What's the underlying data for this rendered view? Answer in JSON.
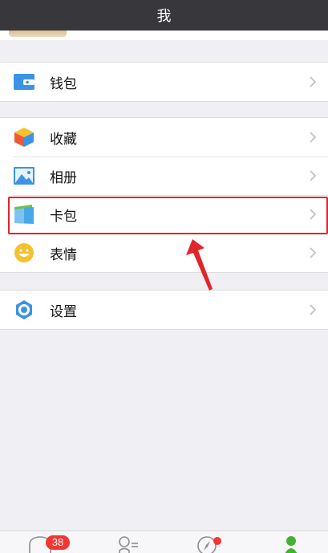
{
  "header": {
    "title": "我"
  },
  "groups": [
    {
      "items": [
        {
          "label": "钱包",
          "icon": "wallet-icon"
        }
      ]
    },
    {
      "items": [
        {
          "label": "收藏",
          "icon": "favorites-cube-icon"
        },
        {
          "label": "相册",
          "icon": "album-photo-icon"
        },
        {
          "label": "卡包",
          "icon": "card-package-icon"
        },
        {
          "label": "表情",
          "icon": "emoji-smile-icon"
        }
      ]
    },
    {
      "items": [
        {
          "label": "设置",
          "icon": "settings-gear-icon"
        }
      ]
    }
  ],
  "tabbar": {
    "chats_badge": "38",
    "tabs": [
      {
        "icon": "chats-bubble-icon"
      },
      {
        "icon": "contacts-icon"
      },
      {
        "icon": "discover-compass-icon",
        "has_dot": true
      },
      {
        "icon": "me-person-icon",
        "active": true
      }
    ]
  },
  "annotation": {
    "highlight_color": "#e0252b"
  }
}
